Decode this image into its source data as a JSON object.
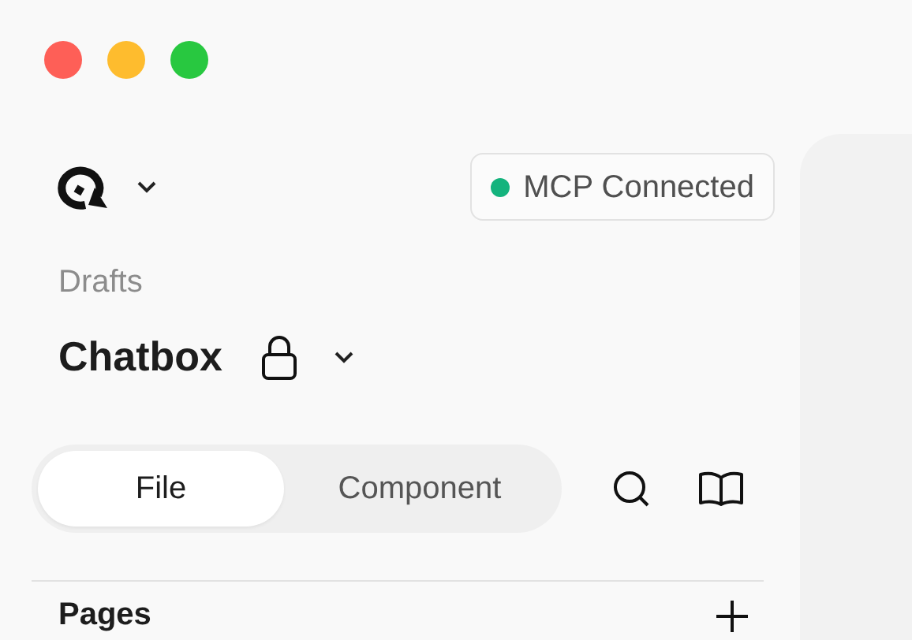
{
  "window_controls": [
    {
      "color": "#fe5f57"
    },
    {
      "color": "#febc2e"
    },
    {
      "color": "#28c840"
    }
  ],
  "status": {
    "label": "MCP Connected",
    "connected": true
  },
  "breadcrumb": "Drafts",
  "file": {
    "title": "Chatbox",
    "locked": true
  },
  "tabs": [
    {
      "label": "File",
      "selected": true
    },
    {
      "label": "Component",
      "selected": false
    }
  ],
  "section": {
    "title": "Pages"
  }
}
